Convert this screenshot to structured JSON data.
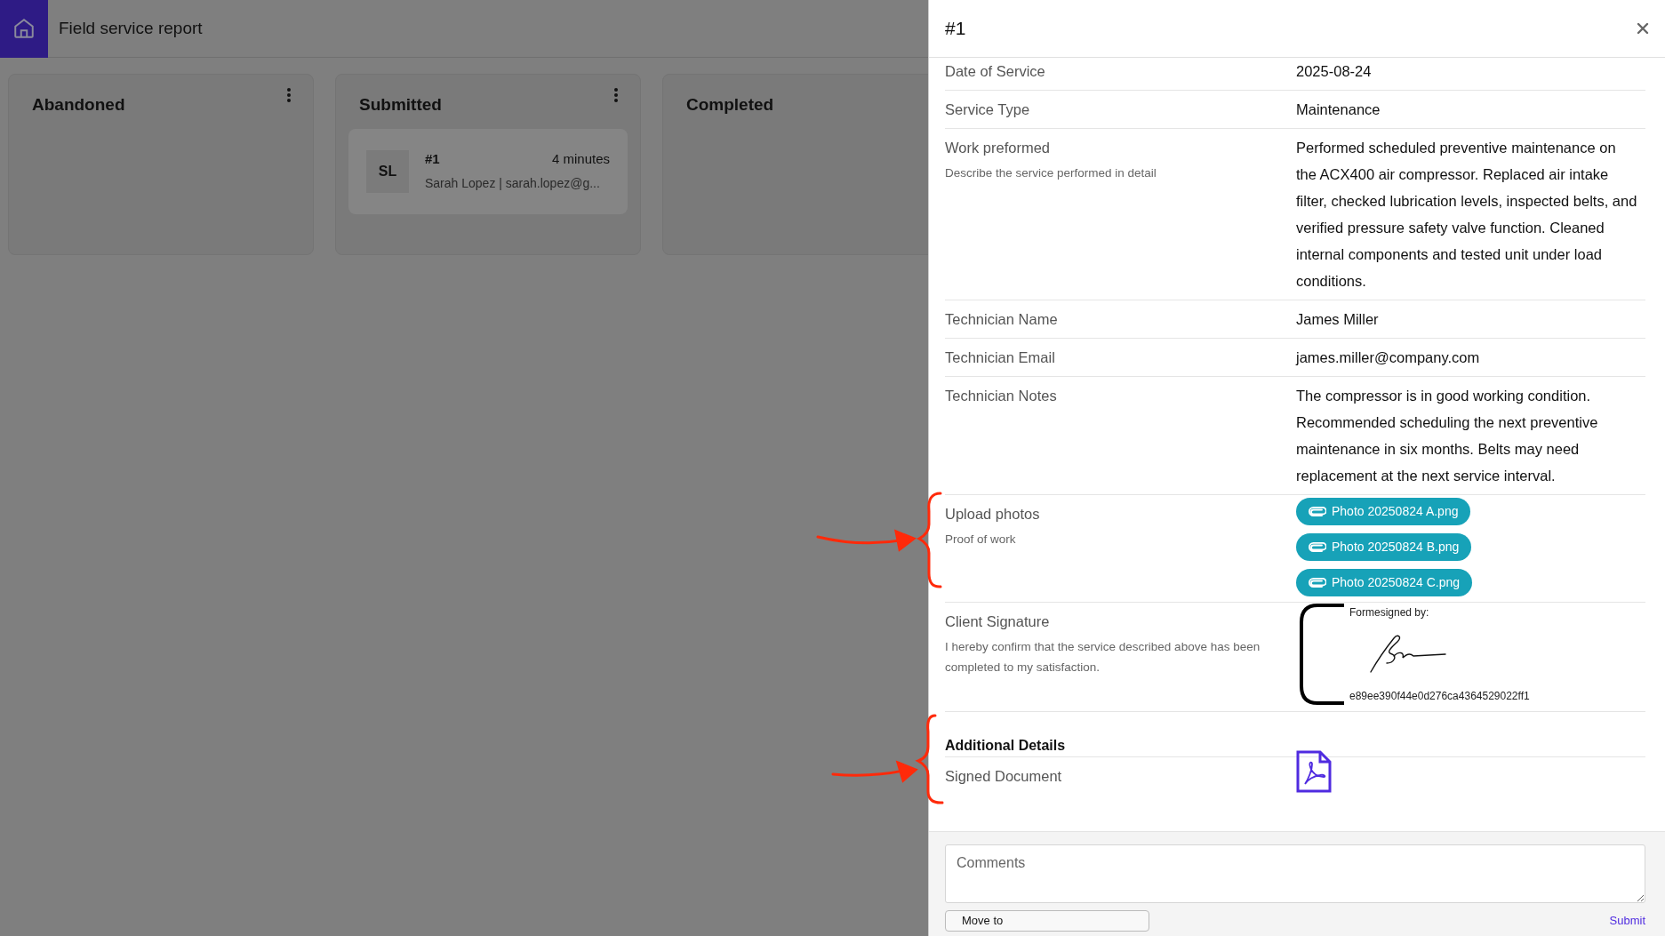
{
  "app": {
    "title": "Field service report"
  },
  "columns": [
    {
      "title": "Abandoned",
      "menu": true
    },
    {
      "title": "Submitted",
      "menu": true,
      "cards": [
        {
          "initials": "SL",
          "title": "#1",
          "time": "4 minutes",
          "subtitle": "Sarah Lopez | sarah.lopez@g..."
        }
      ]
    },
    {
      "title": "Completed",
      "menu": false
    }
  ],
  "panel": {
    "title": "#1",
    "fields": [
      {
        "kind": "text",
        "label": "Date of Service",
        "value": "2025-08-24"
      },
      {
        "kind": "text",
        "label": "Service Type",
        "value": "Maintenance"
      },
      {
        "kind": "text",
        "label": "Work preformed",
        "hint": "Describe the service performed in detail",
        "value": "Performed scheduled preventive maintenance on the ACX400 air compressor. Replaced air intake filter, checked lubrication levels, inspected belts, and verified pressure safety valve function. Cleaned internal components and tested unit under load conditions."
      },
      {
        "kind": "text",
        "label": "Technician Name",
        "value": "James Miller"
      },
      {
        "kind": "text",
        "label": "Technician Email",
        "value": "james.miller@company.com"
      },
      {
        "kind": "text",
        "label": "Technician Notes",
        "value": "The compressor is in good working condition. Recommended scheduling the next preventive maintenance in six months. Belts may need replacement at the next service interval."
      },
      {
        "kind": "files",
        "label": "Upload photos",
        "hint": "Proof of work",
        "files": [
          "Photo 20250824 A.png",
          "Photo 20250824 B.png",
          "Photo 20250824 C.png"
        ]
      },
      {
        "kind": "signature",
        "label": "Client Signature",
        "hint": "I hereby confirm that the service described above has been completed to my satisfaction.",
        "caption": "Formesigned by:",
        "hash": "e89ee390f44e0d276ca4364529022ff1"
      }
    ],
    "section": {
      "title": "Additional Details",
      "fields": [
        {
          "kind": "document",
          "label": "Signed Document"
        }
      ]
    },
    "comments": {
      "placeholder": "Comments"
    },
    "move_button": "Move to",
    "submit": "Submit"
  }
}
